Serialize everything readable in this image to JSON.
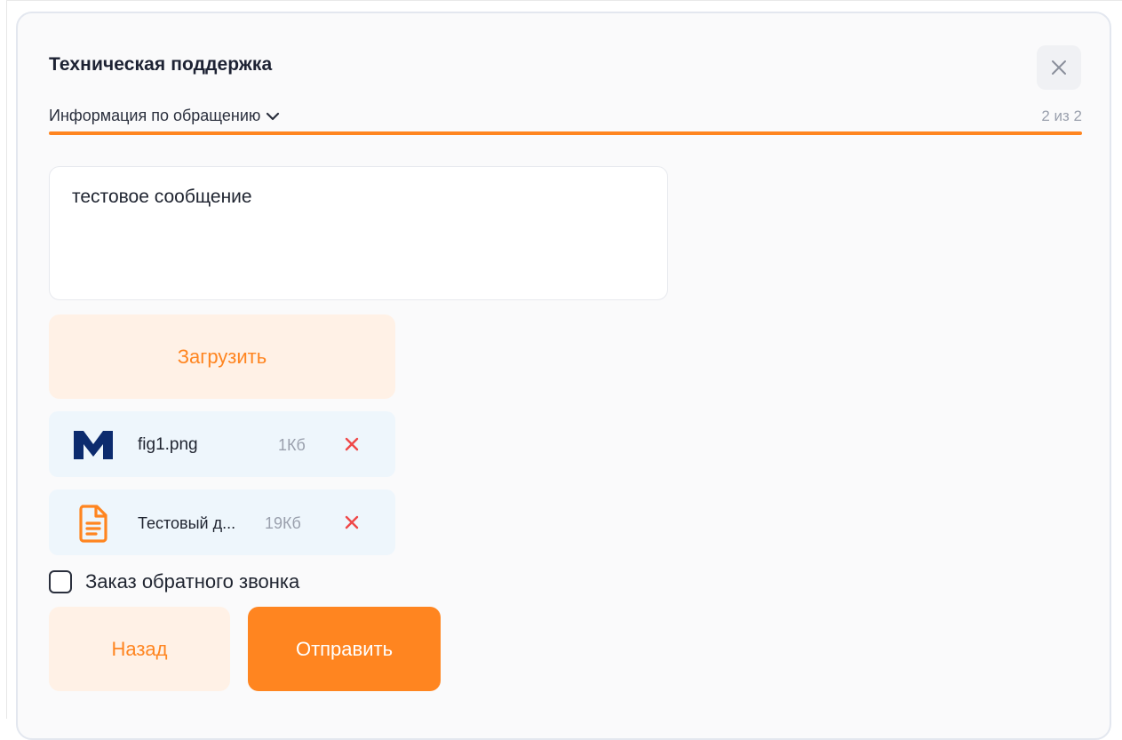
{
  "header": {
    "title": "Техническая поддержка",
    "close_icon": "close-icon"
  },
  "section": {
    "title": "Информация по обращению",
    "expand_icon": "chevron-down-icon",
    "step_counter": "2 из 2",
    "progress": 1.0
  },
  "message": {
    "value": "тестовое сообщение"
  },
  "upload": {
    "label": "Загрузить"
  },
  "files": [
    {
      "icon": "image-file-icon",
      "name": "fig1.png",
      "size": "1Кб",
      "remove_icon": "remove-file-icon"
    },
    {
      "icon": "document-file-icon",
      "name": "Тестовый д...",
      "size": "19Кб",
      "remove_icon": "remove-file-icon"
    }
  ],
  "callback": {
    "label": "Заказ обратного звонка",
    "checked": false
  },
  "actions": {
    "back_label": "Назад",
    "submit_label": "Отправить"
  },
  "colors": {
    "accent": "#ff8520",
    "accent_light": "#fff1e6",
    "file_bg": "#eef6fc",
    "remove_red": "#ef4848",
    "file_icon_navy": "#0c2b6e"
  }
}
